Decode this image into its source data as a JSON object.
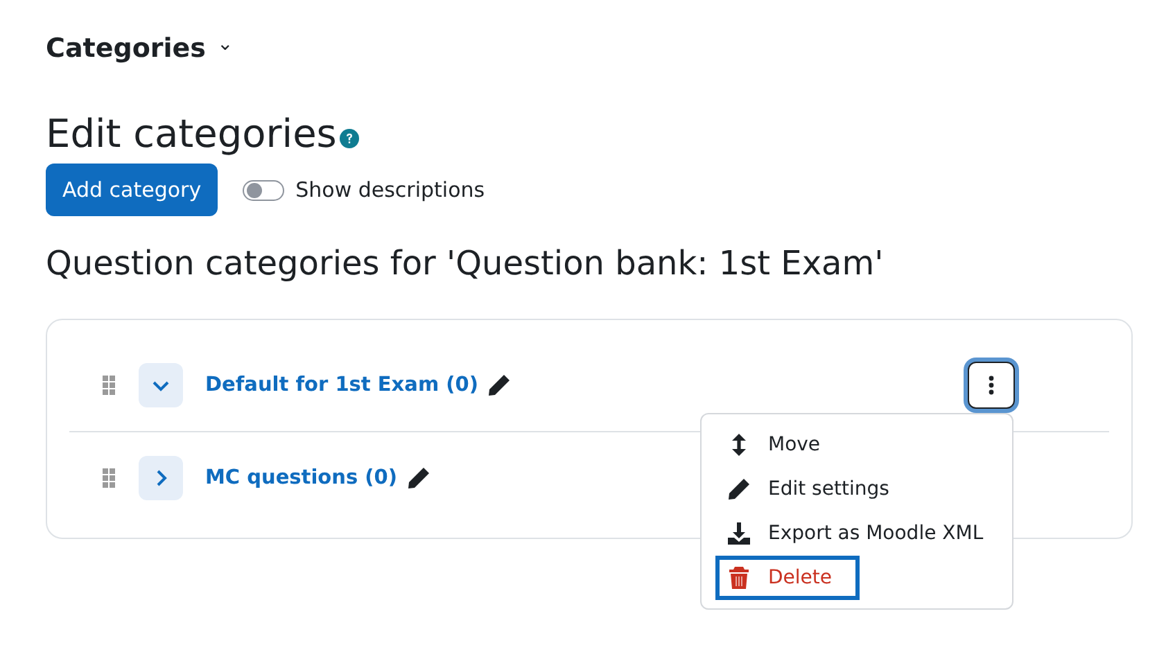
{
  "nav_title": "Categories",
  "nav_caret": "⌄",
  "heading": "Edit categories",
  "add_button": "Add category",
  "show_descriptions": {
    "label": "Show descriptions",
    "on": false
  },
  "subheading": "Question categories for 'Question bank: 1st Exam'",
  "categories": [
    {
      "name": "Default for 1st Exam (0)",
      "expanded": true,
      "menu_open": true
    },
    {
      "name": "MC questions (0)",
      "expanded": false,
      "menu_open": false
    }
  ],
  "menu": [
    {
      "kind": "move",
      "label": "Move",
      "selected": false
    },
    {
      "kind": "edit",
      "label": "Edit settings",
      "selected": false
    },
    {
      "kind": "export",
      "label": "Export as Moodle XML",
      "selected": false
    },
    {
      "kind": "delete",
      "label": "Delete",
      "selected": true
    }
  ]
}
